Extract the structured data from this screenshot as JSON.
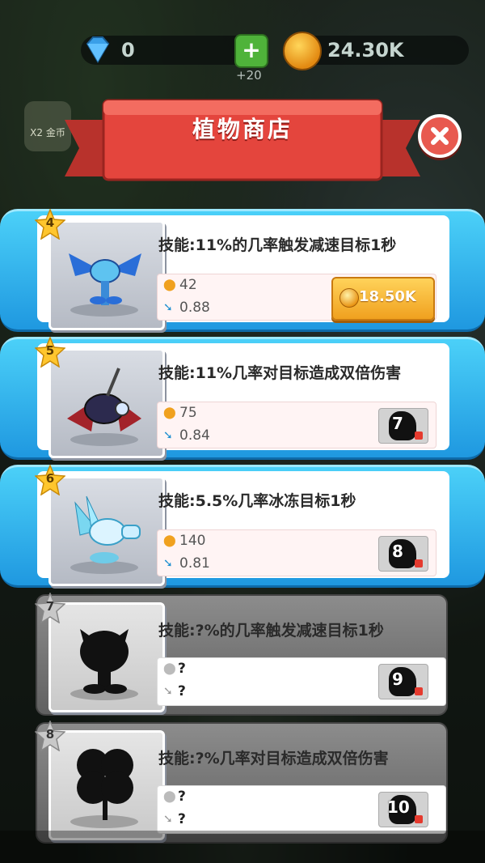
{
  "hud": {
    "gems": "0",
    "plus": "+",
    "plus_sub": "+20",
    "coins": "24.30K",
    "x2_label": "X2 金币"
  },
  "shop": {
    "title": "植物商店"
  },
  "colors": {
    "unlocked_band": "#2fb2ef",
    "locked_band": "#777777",
    "price_button": "#f5b12f",
    "banner_red": "#e4453d"
  },
  "items": [
    {
      "level": "4",
      "skill": "技能:11%的几率触发减速目标1秒",
      "attack": "42",
      "speed": "0.88",
      "price": "18.50K",
      "state": "buy",
      "icon": "ice-dragon-plant-icon"
    },
    {
      "level": "5",
      "skill": "技能:11%几率对目标造成双倍伤害",
      "attack": "75",
      "speed": "0.84",
      "unlock": "7",
      "state": "locked-unlock",
      "icon": "dark-bat-plant-icon"
    },
    {
      "level": "6",
      "skill": "技能:5.5%几率冰冻目标1秒",
      "attack": "140",
      "speed": "0.81",
      "unlock": "8",
      "state": "locked-unlock",
      "icon": "ice-crystal-peashooter-icon"
    },
    {
      "level": "7",
      "skill": "技能:?%的几率触发减速目标1秒",
      "attack": "?",
      "speed": "?",
      "unlock": "9",
      "state": "hidden",
      "icon": "silhouette-plant-icon"
    },
    {
      "level": "8",
      "skill": "技能:?%几率对目标造成双倍伤害",
      "attack": "?",
      "speed": "?",
      "unlock": "10",
      "state": "hidden",
      "icon": "silhouette-clover-icon"
    }
  ]
}
